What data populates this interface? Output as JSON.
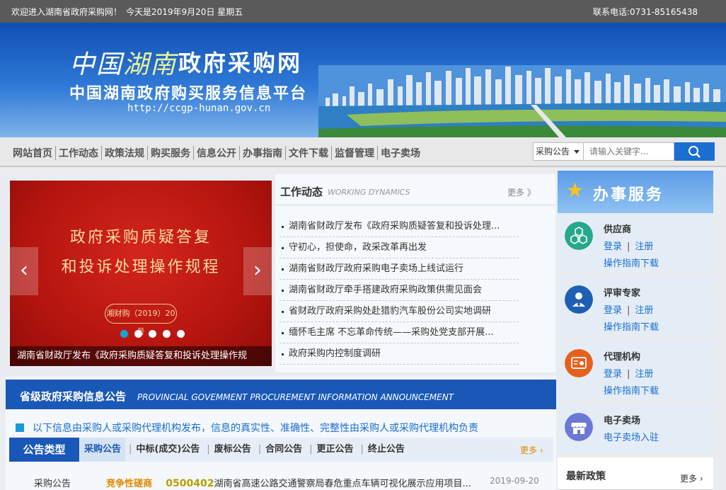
{
  "topbar": {
    "welcome": "欢迎进入湖南省政府采购网！",
    "date": "今天是2019年9月20日 星期五",
    "phone": "联系电话:0731-85165438"
  },
  "banner": {
    "logo_part1": "中国",
    "logo_part2": "湖南",
    "site_title": "政府采购网",
    "platform": "中国湖南政府购买服务信息平台",
    "url": "http://ccgp-hunan.gov.cn"
  },
  "nav": {
    "items": [
      "网站首页",
      "工作动态",
      "政策法规",
      "购买服务",
      "信息公开",
      "办事指南",
      "文件下载",
      "监督管理",
      "电子卖场"
    ],
    "search_select": "采购公告",
    "search_placeholder": "请输入关键字..."
  },
  "slider": {
    "line1": "政府采购质疑答复",
    "line2": "和投诉处理操作规程",
    "badge": "湘财购（2019）20号",
    "caption": "湖南省财政厅发布《政府采购质疑答复和投诉处理操作规",
    "prev": "‹",
    "next": "›"
  },
  "work": {
    "title_cn": "工作动态",
    "title_en": "WORKING DYNAMICS",
    "more": "更多 》",
    "items": [
      "湖南省财政厅发布《政府采购质疑答复和投诉处理...",
      "守初心，担使命，政采改革再出发",
      "湖南省财政厅政府采购电子卖场上线试运行",
      "湖南省财政厅牵手搭建政府采购政策供需见面会",
      "省财政厅政府采购处赴猎豹汽车股份公司实地调研",
      "缅怀毛主席 不忘革命传统——采购处党支部开展...",
      "政府采购内控制度调研"
    ]
  },
  "provincial": {
    "title_cn": "省级政府采购信息公告",
    "title_en": "PROVINCIAL GOVEMMENT PROCUREMENT INFORMATION ANNOUNCEMENT",
    "notice": "以下信息由采购人或采购代理机构发布，信息的真实性、准确性、完整性由采购人或采购代理机构负责",
    "type_label": "公告类型",
    "tabs": [
      "采购公告",
      "中标(成交)公告",
      "废标公告",
      "合同公告",
      "更正公告",
      "终止公告"
    ],
    "more": "更多 ›",
    "row": {
      "type": "采购公告",
      "method": "竞争性磋商",
      "code": "0500402",
      "title": "湖南省高速公路交通警察局春危重点车辆可视化展示应用项目...",
      "date": "2019-09-20"
    }
  },
  "service": {
    "title": "办事服务",
    "login": "登录",
    "register": "注册",
    "guide": "操作指南下载",
    "cards": [
      {
        "name": "供应商"
      },
      {
        "name": "评审专家"
      },
      {
        "name": "代理机构"
      },
      {
        "name": "电子卖场",
        "link": "电子卖场入驻"
      }
    ],
    "policy_title": "最新政策",
    "policy_more": "更多 ›"
  },
  "colors": {
    "brand_blue": "#1a58b8",
    "link_blue": "#1a6fd0",
    "accent_orange": "#e08a00",
    "slider_red": "#c41a12"
  }
}
